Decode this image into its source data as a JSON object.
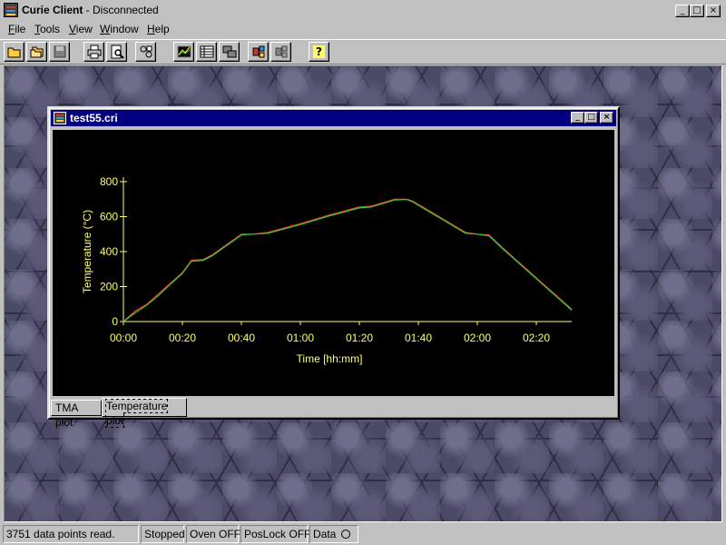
{
  "app": {
    "title": "Curie Client",
    "title_suffix": " - Disconnected"
  },
  "window_buttons": {
    "minimize": "_",
    "maximize": "□",
    "close": "×"
  },
  "menu": [
    {
      "label": "File",
      "accel": "F",
      "rest": "ile"
    },
    {
      "label": "Tools",
      "accel": "T",
      "rest": "ools"
    },
    {
      "label": "View",
      "accel": "V",
      "rest": "iew"
    },
    {
      "label": "Window",
      "accel": "W",
      "rest": "indow"
    },
    {
      "label": "Help",
      "accel": "H",
      "rest": "elp"
    }
  ],
  "toolbar": {
    "help_glyph": "?"
  },
  "document": {
    "title": "test55.cri",
    "tabs": [
      "TMA plot",
      "Temperature plot"
    ],
    "active_tab": "Temperature plot"
  },
  "chart_data": {
    "type": "line",
    "xlabel": "Time [hh:mm]",
    "ylabel": "Temperature (°C)",
    "x_ticks": [
      "00:00",
      "00:20",
      "00:40",
      "01:00",
      "01:20",
      "01:40",
      "02:00",
      "02:20"
    ],
    "x_tick_minutes": [
      0,
      20,
      40,
      60,
      80,
      100,
      120,
      140
    ],
    "y_ticks": [
      "0",
      "200",
      "400",
      "600",
      "800"
    ],
    "xlim_minutes": [
      0,
      152
    ],
    "ylim": [
      0,
      800
    ],
    "axis_color": "#ffff66",
    "series": [
      {
        "color": "#ff3333",
        "x_minutes": [
          0,
          4,
          8,
          12,
          16,
          20,
          23,
          27,
          30,
          35,
          40,
          44,
          49,
          60,
          70,
          80,
          84,
          88,
          92,
          96,
          98,
          100,
          104,
          108,
          112,
          116,
          120,
          124,
          128,
          132,
          136,
          140,
          144,
          148,
          152
        ],
        "y": [
          0,
          60,
          100,
          160,
          220,
          280,
          350,
          355,
          380,
          440,
          500,
          500,
          510,
          560,
          610,
          655,
          660,
          680,
          700,
          700,
          690,
          670,
          630,
          590,
          550,
          510,
          500,
          495,
          430,
          370,
          310,
          250,
          190,
          130,
          70
        ]
      },
      {
        "color": "#33cc33",
        "x_minutes": [
          0,
          4,
          8,
          12,
          16,
          20,
          23,
          27,
          30,
          35,
          40,
          44,
          49,
          60,
          70,
          80,
          84,
          88,
          92,
          96,
          98,
          100,
          104,
          108,
          112,
          116,
          120,
          124,
          128,
          132,
          136,
          140,
          144,
          148,
          152
        ],
        "y": [
          0,
          50,
          95,
          150,
          215,
          275,
          345,
          350,
          375,
          435,
          495,
          500,
          505,
          555,
          605,
          650,
          655,
          675,
          695,
          698,
          685,
          665,
          625,
          585,
          545,
          505,
          500,
          490,
          425,
          365,
          305,
          245,
          185,
          125,
          65
        ]
      }
    ]
  },
  "status": {
    "points": "3751 data points read.",
    "state": "Stopped",
    "oven": "Oven OFF",
    "poslock": "PosLock OFF",
    "data": "Data"
  }
}
